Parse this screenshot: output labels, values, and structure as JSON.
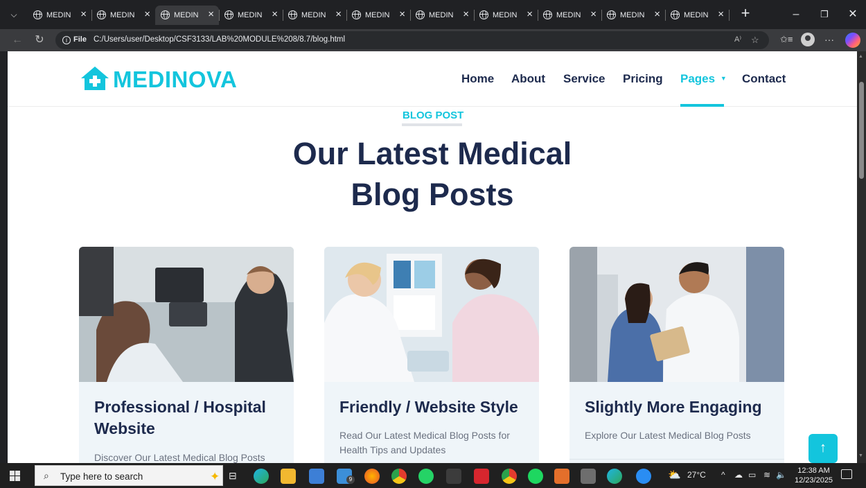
{
  "browser": {
    "tabs": [
      {
        "title": "MEDIN"
      },
      {
        "title": "MEDIN"
      },
      {
        "title": "MEDIN"
      },
      {
        "title": "MEDIN"
      },
      {
        "title": "MEDIN"
      },
      {
        "title": "MEDIN"
      },
      {
        "title": "MEDIN"
      },
      {
        "title": "MEDIN"
      },
      {
        "title": "MEDIN"
      },
      {
        "title": "MEDIN"
      },
      {
        "title": "MEDIN"
      }
    ],
    "active_tab_index": 2,
    "file_chip": "File",
    "url": "C:/Users/user/Desktop/CSF3133/LAB%20MODULE%208/8.7/blog.html"
  },
  "site": {
    "brand": "MEDINOVA",
    "brand_color": "#13c5dd",
    "text_color": "#1d2a4d",
    "nav": {
      "home": "Home",
      "about": "About",
      "service": "Service",
      "pricing": "Pricing",
      "pages": "Pages",
      "contact": "Contact"
    },
    "active_nav": "Pages",
    "section_label": "BLOG POST",
    "heading_line1": "Our Latest Medical",
    "heading_line2": "Blog Posts",
    "cards": [
      {
        "title": "Professional / Hospital Website",
        "text": "Discover Our Latest Medical Blog Posts",
        "image": "dental-clinic-photo"
      },
      {
        "title": "Friendly / Website Style",
        "text": "Read Our Latest Medical Blog Posts for Health Tips and Updates",
        "image": "doctor-patient-photo"
      },
      {
        "title": "Slightly More Engaging",
        "text": "Explore Our Latest Medical Blog Posts",
        "image": "doctors-consult-photo"
      }
    ]
  },
  "taskbar": {
    "search_placeholder": "Type here to search",
    "weather": "27°C",
    "time": "12:38 AM",
    "date": "12/23/2025",
    "mail_badge": "9"
  }
}
